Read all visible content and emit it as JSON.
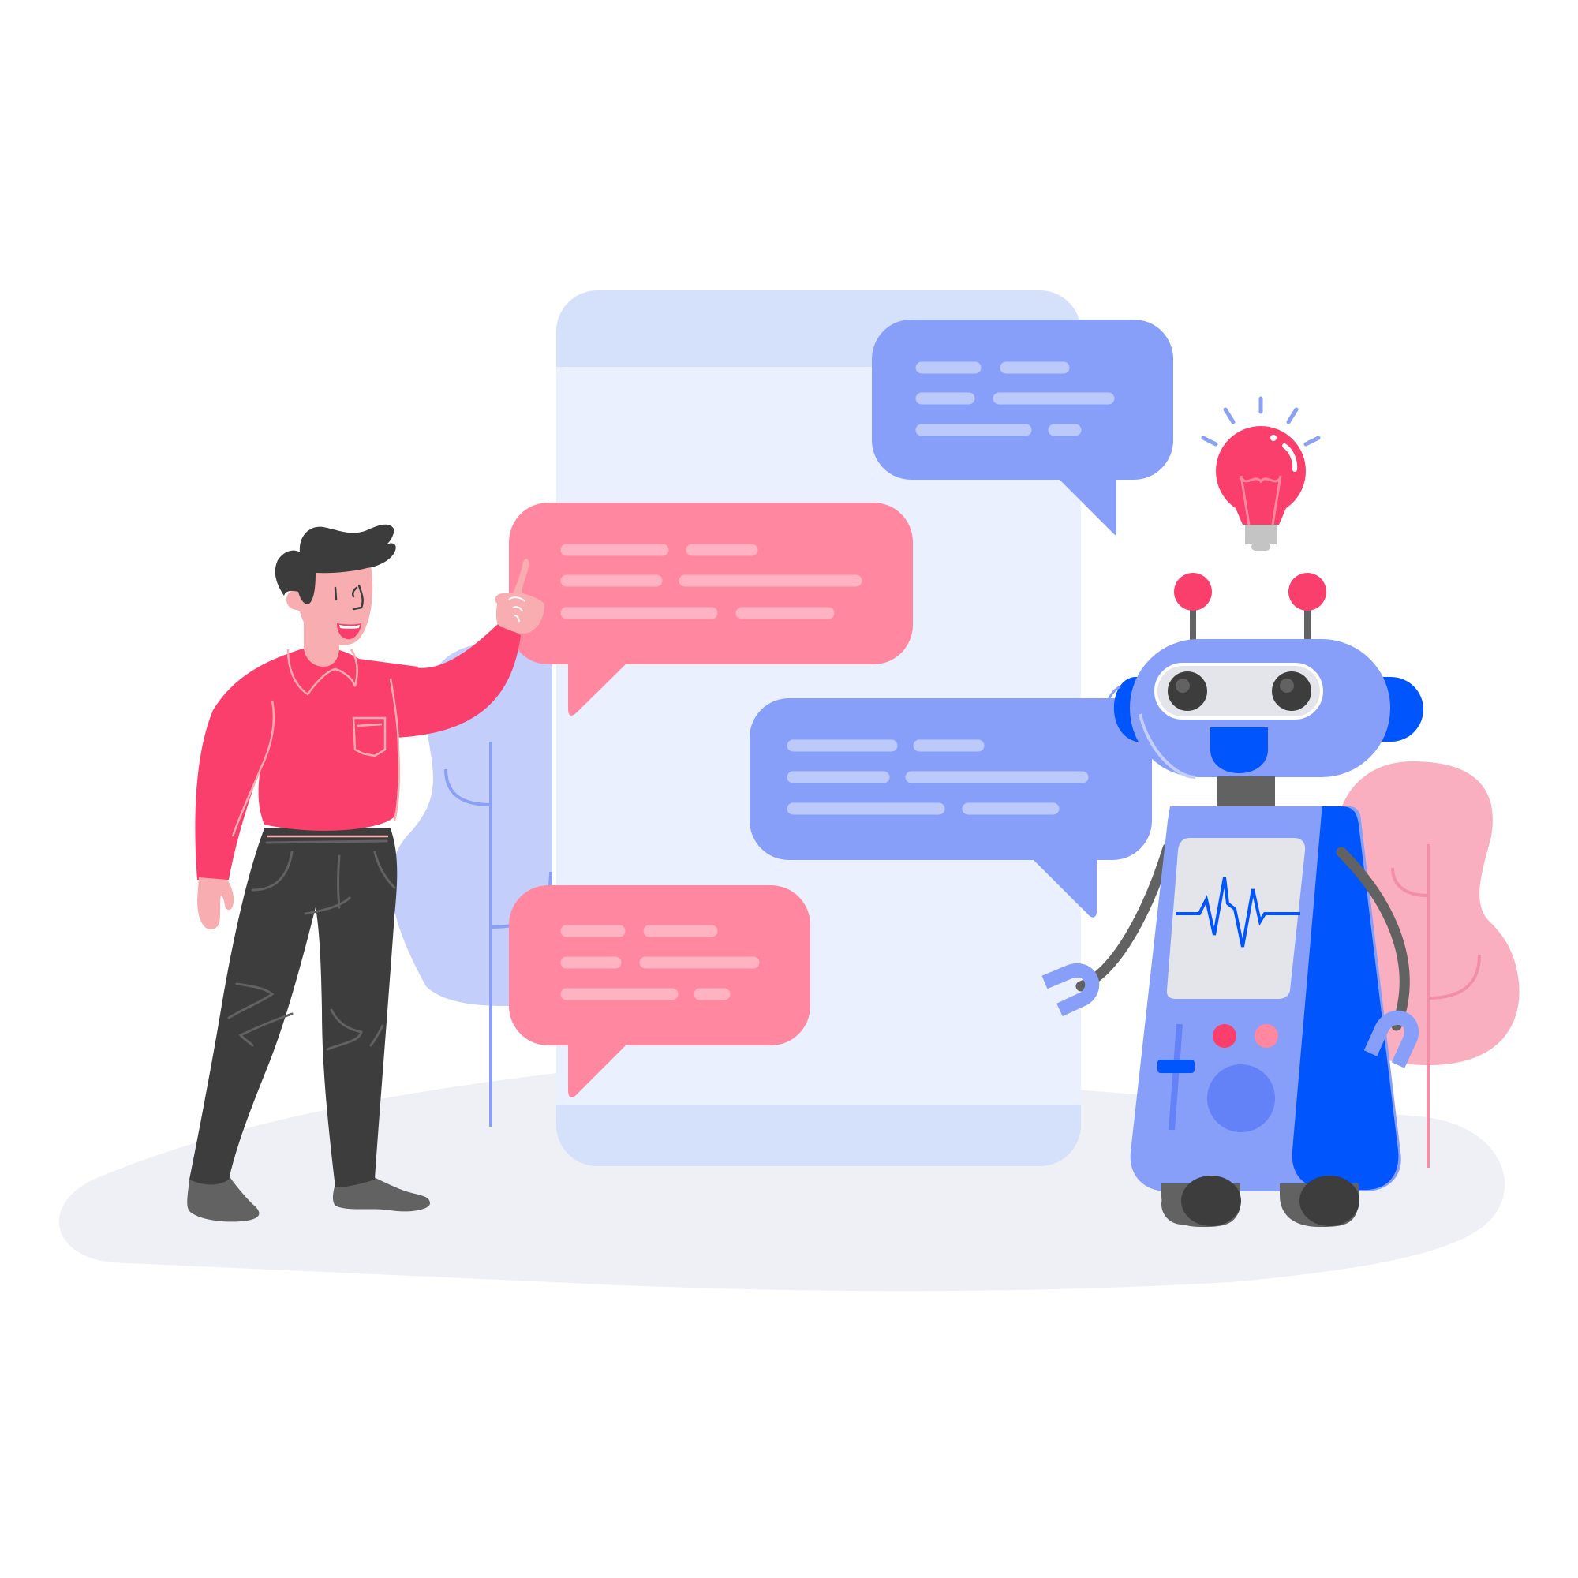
{
  "illustration": {
    "subject": "chatbot-conversation",
    "icons": [
      "phone-icon",
      "chat-bubble-icon",
      "robot-icon",
      "lightbulb-icon",
      "person-figure",
      "tree-icon",
      "magnet-hand-icon",
      "heartbeat-monitor-icon"
    ]
  },
  "palette": {
    "background": "#ffffff",
    "ground": "#eef0f6",
    "phone_frame": "#d5e0fb",
    "phone_screen": "#eaf0fe",
    "bubble_pink": "#ff879f",
    "bubble_pink_line": "#ffb3c2",
    "bubble_blue": "#879ff9",
    "bubble_blue_line": "#bcc9fb",
    "shirt": "#fb3f6c",
    "skin": "#f8adb0",
    "hair": "#3c3c3c",
    "pants": "#3d3d3d",
    "robot_body": "#879ff9",
    "robot_accent": "#0055fd",
    "robot_dark": "#626262",
    "bulb": "#fb3f6c",
    "tree_blue": "#c3cefa",
    "tree_pink": "#f9afc0"
  }
}
